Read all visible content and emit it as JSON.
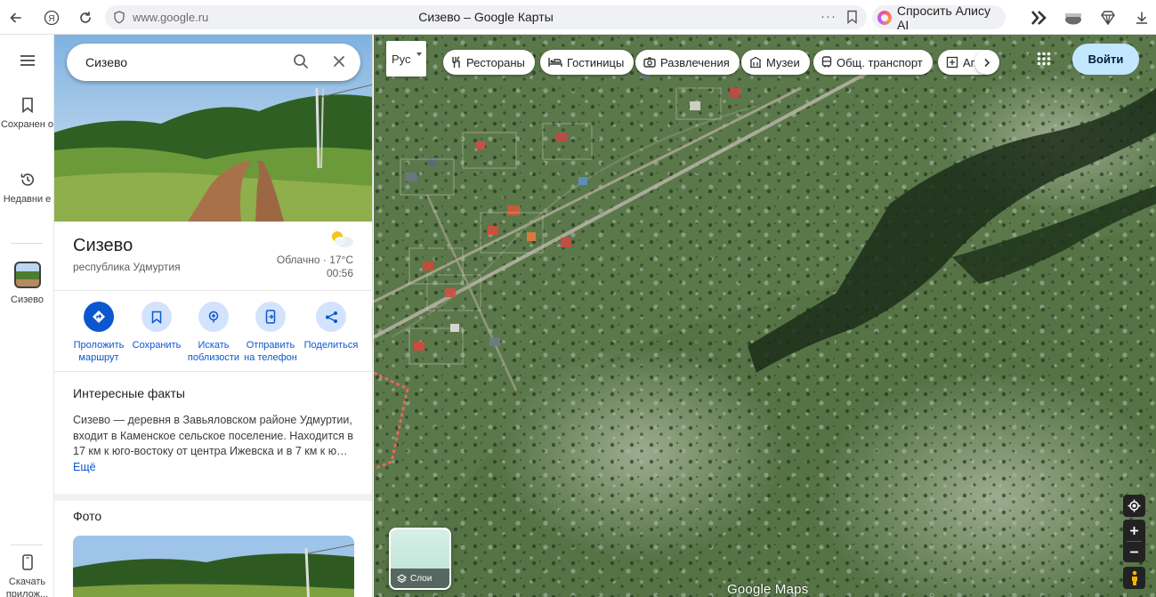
{
  "browser": {
    "url": "www.google.ru",
    "page_title": "Сизево – Google Карты",
    "more": "···",
    "alice_label": "Спросить Алису AI"
  },
  "rail": {
    "saved": "Сохранен о",
    "recent": "Недавни е",
    "place": "Сизево",
    "download": "Скачать прилож..."
  },
  "search": {
    "value": "Сизево"
  },
  "place": {
    "name": "Сизево",
    "region": "республика Удмуртия",
    "weather": "Облачно · 17°C",
    "time": "00:56"
  },
  "actions": [
    {
      "label": "Проложить маршрут"
    },
    {
      "label": "Сохранить"
    },
    {
      "label": "Искать поблизости"
    },
    {
      "label": "Отправить на телефон"
    },
    {
      "label": "Поделиться"
    }
  ],
  "facts": {
    "title": "Интересные факты",
    "text": "Сизево — деревня в Завьяловском районе Удмуртии, входит в Каменское сельское поселение. Находится в 17 км к юго-востоку от центра Ижевска и в 7 км к ю…",
    "more": "Ещё"
  },
  "photos": {
    "title": "Фото"
  },
  "map": {
    "lang": "Рус",
    "chips": [
      "Рестораны",
      "Гостиницы",
      "Развлечения",
      "Музеи",
      "Общ. транспорт",
      "Ап"
    ],
    "signin": "Войти",
    "layers": "Слои",
    "brand": "Google Maps"
  }
}
